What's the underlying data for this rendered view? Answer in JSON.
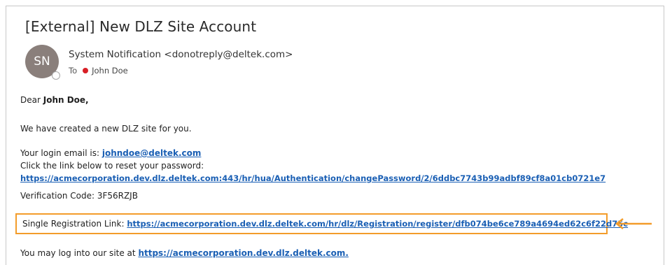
{
  "email": {
    "subject": "[External] New DLZ Site Account",
    "avatar_initials": "SN",
    "sender": "System Notification <donotreply@deltek.com>",
    "to_label": "To",
    "to_name": "John Doe",
    "greeting_prefix": "Dear ",
    "greeting_name": "John Doe,",
    "line_created": "We have created a new DLZ site for you.",
    "login_label": "Your login email is:",
    "login_email": "johndoe@deltek.com",
    "reset_text": "Click the link below to reset your password:",
    "reset_link": "https://acmecorporation.dev.dlz.deltek.com:443/hr/hua/Authentication/changePassword/2/6ddbc7743b99adbf89cf8a01cb0721e7",
    "verification": "Verification Code: 3F56RZJB",
    "registration_label": "Single Registration Link:",
    "registration_link": "https://acmecorporation.dev.dlz.deltek.com/hr/dlz/Registration/register/dfb074be6ce789a4694ed62c6f22d75c",
    "login_site_text": "You may log into our site at",
    "login_site_link": "https://acmecorporation.dev.dlz.deltek.com."
  },
  "colors": {
    "highlight": "#f39c2a",
    "link": "#1a5fb4",
    "avatar_bg": "#8a7f7b",
    "presence_red": "#d81f26"
  },
  "icons": [
    "presence-dot-icon",
    "arrow-left-icon"
  ]
}
